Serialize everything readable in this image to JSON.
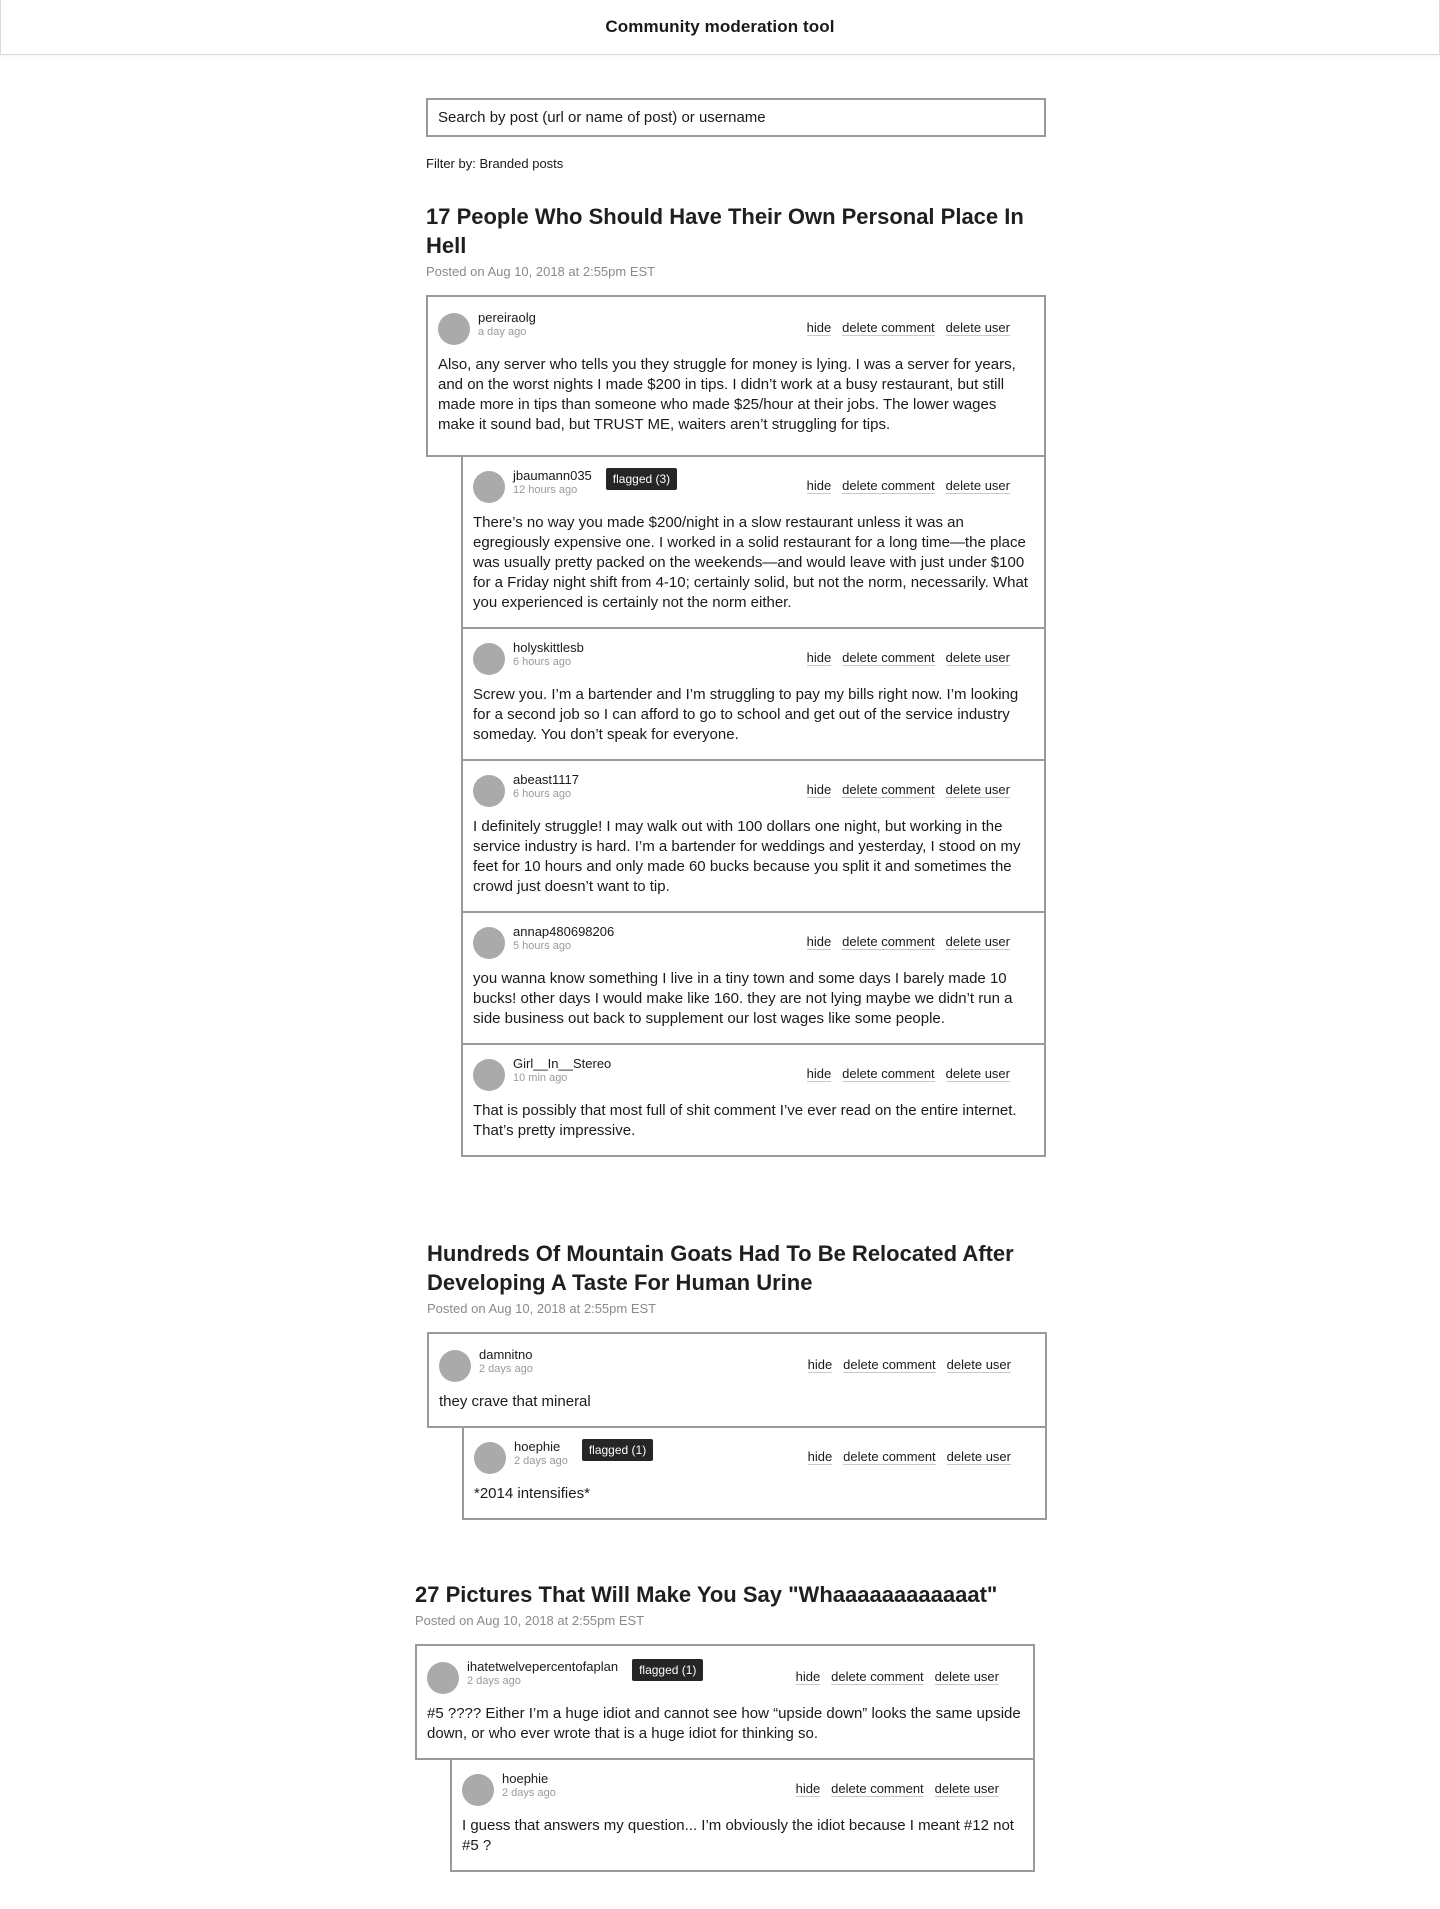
{
  "header": {
    "title": "Community moderation tool"
  },
  "search": {
    "placeholder": "Search by post (url or name of post) or username"
  },
  "filter": {
    "label": "Filter by: Branded posts"
  },
  "actions": {
    "hide": "hide",
    "delete_comment": "delete comment",
    "delete_user": "delete user"
  },
  "colors": {
    "avatar": "#aaaaaa",
    "flag_bg": "#262626",
    "border": "#9a9a9a"
  },
  "posts": [
    {
      "title": "17 People Who Should Have Their Own Personal Place In Hell",
      "meta": "Posted on Aug 10, 2018 at 2:55pm EST",
      "comments": [
        {
          "user": "pereiraolg",
          "time": "a day ago",
          "flag": "",
          "text": "Also, any server who tells you they struggle for money is lying. I was a server for years, and on the worst nights I made $200 in tips. I didn’t work at a busy restaurant, but still made more in tips than someone who made $25/hour at their jobs. The lower wages make it sound bad, but TRUST ME, waiters aren’t struggling for tips."
        },
        {
          "user": "jbaumann035",
          "time": "12 hours ago",
          "flag": "flagged (3)",
          "text": "There’s no way you made $200/night in a slow restaurant unless it was an egregiously expensive one. I worked in a solid restaurant for a long time—the place was usually pretty packed on the weekends—and would leave with just under $100 for a Friday night shift from 4-10; certainly solid, but not the norm, necessarily. What you experienced is certainly not the norm either."
        },
        {
          "user": "holyskittlesb",
          "time": "6 hours ago",
          "flag": "",
          "text": "Screw you. I’m a bartender and I’m struggling to pay my bills right now. I’m looking for a second job so I can afford to go to school and get out of the service industry someday. You don’t speak for everyone."
        },
        {
          "user": "abeast1117",
          "time": "6 hours ago",
          "flag": "",
          "text": "I definitely struggle! I may walk out with 100 dollars one night, but working in the service industry is hard. I’m a bartender for weddings and yesterday, I stood on my feet for 10 hours and only made 60 bucks because you split it and sometimes the crowd just doesn’t want to tip."
        },
        {
          "user": "annap480698206",
          "time": "5 hours ago",
          "flag": "",
          "text": "you wanna know something I live in a tiny town and some days I barely made 10 bucks! other days I would make like 160. they are not lying maybe we didn’t run a side business out back to supplement our lost wages like some people."
        },
        {
          "user": "Girl__In__Stereo",
          "time": "10 min ago",
          "flag": "",
          "text": "That is possibly that most full of shit comment I’ve ever read on the entire internet. That’s pretty impressive."
        }
      ]
    },
    {
      "title": "Hundreds Of Mountain Goats Had To Be Relocated After Developing A Taste For Human Urine",
      "meta": "Posted on Aug 10, 2018 at 2:55pm EST",
      "comments": [
        {
          "user": "damnitno",
          "time": "2 days ago",
          "flag": "",
          "text": "they crave that mineral"
        },
        {
          "user": "hoephie",
          "time": "2 days ago",
          "flag": "flagged (1)",
          "text": "*2014 intensifies*"
        }
      ]
    },
    {
      "title": "27 Pictures That Will Make You Say \"Whaaaaaaaaaaaat\"",
      "meta": "Posted on Aug 10, 2018 at 2:55pm EST",
      "comments": [
        {
          "user": "ihatetwelvepercentofaplan",
          "time": "2 days ago",
          "flag": "flagged (1)",
          "text": "#5 ???? Either I’m a huge idiot and cannot see how “upside down” looks the same upside down, or who ever wrote that is a huge idiot for thinking so."
        },
        {
          "user": "hoephie",
          "time": "2 days ago",
          "flag": "",
          "text": "I guess that answers my question... I’m obviously the idiot because I meant #12 not #5 ?"
        }
      ]
    }
  ]
}
